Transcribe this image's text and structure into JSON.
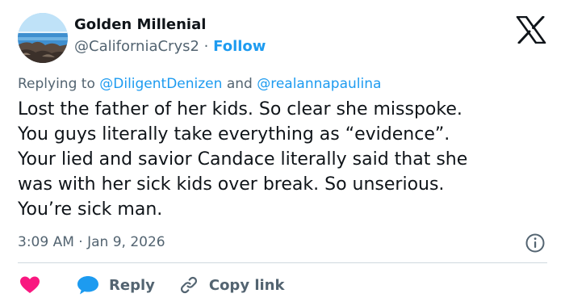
{
  "author": {
    "display_name": "Golden Millenial",
    "handle": "@CaliforniaCrys2",
    "separator": "·",
    "follow_label": "Follow"
  },
  "reply_context": {
    "prefix": "Replying to",
    "mention_1": "@DiligentDenizen",
    "conjunction": "and",
    "mention_2": "@realannapaulina"
  },
  "tweet": {
    "lines": [
      "Lost the father of her kids. So clear she misspoke.",
      "You guys literally take everything as “evidence”.",
      "Your lied and savior Candace literally said that she",
      "was with her sick kids over break. So unserious.",
      "You’re sick man."
    ],
    "time": "3:09 AM",
    "separator": "·",
    "date": "Jan 9, 2026"
  },
  "actions": {
    "reply_label": "Reply",
    "copy_link_label": "Copy link"
  },
  "icons": {
    "logo": "x-logo-icon",
    "info": "info-icon",
    "like": "heart-icon",
    "reply": "speech-bubble-icon",
    "copy_link": "link-icon"
  },
  "colors": {
    "text": "#0f1419",
    "secondary": "#536471",
    "accent": "#1d9bf0",
    "like": "#f91880",
    "divider": "#cfd9de"
  }
}
